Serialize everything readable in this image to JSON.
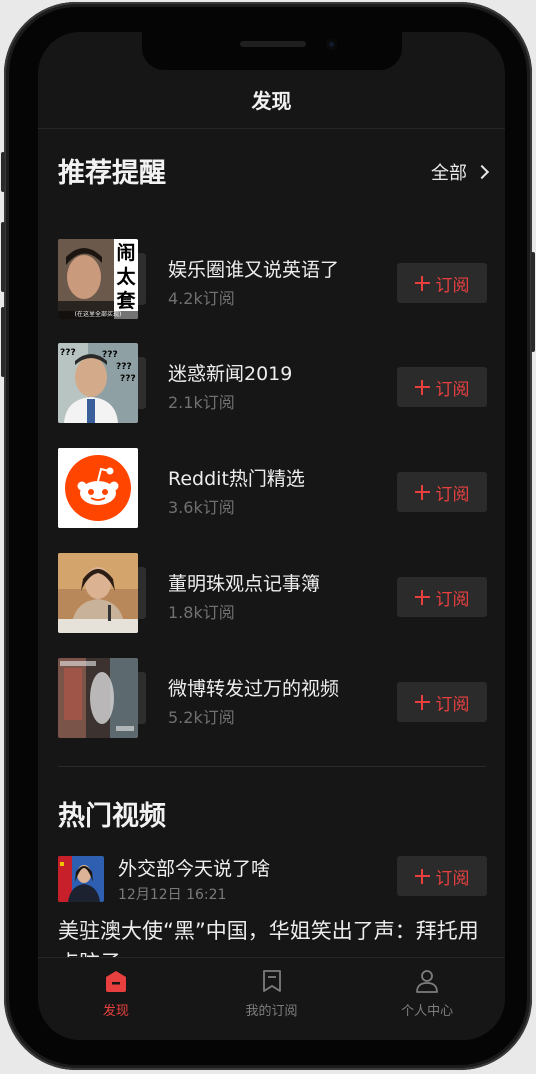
{
  "header": {
    "title": "发现"
  },
  "recommend": {
    "title": "推荐提醒",
    "see_all": "全部",
    "thumb_overlay_text": "闹太套",
    "thumb_caption_text": "(在这里全部买现)",
    "items": [
      {
        "title": "娱乐圈谁又说英语了",
        "subscribers": "4.2k订阅",
        "button": "订阅",
        "thumb": "portrait-man-icon"
      },
      {
        "title": "迷惑新闻2019",
        "subscribers": "2.1k订阅",
        "button": "订阅",
        "thumb": "confused-man-icon"
      },
      {
        "title": "Reddit热门精选",
        "subscribers": "3.6k订阅",
        "button": "订阅",
        "thumb": "reddit-logo-icon"
      },
      {
        "title": "董明珠观点记事簿",
        "subscribers": "1.8k订阅",
        "button": "订阅",
        "thumb": "woman-speaking-icon"
      },
      {
        "title": "微博转发过万的视频",
        "subscribers": "5.2k订阅",
        "button": "订阅",
        "thumb": "video-still-icon"
      }
    ]
  },
  "hot_videos": {
    "title": "热门视频",
    "item": {
      "title": "外交部今天说了啥",
      "time": "12月12日 16:21",
      "button": "订阅",
      "text": "美驻澳大使“黑”中国，华姐笑出了声：拜托用点脑子。"
    }
  },
  "tabs": [
    {
      "label": "发现",
      "icon": "home-icon",
      "active": true
    },
    {
      "label": "我的订阅",
      "icon": "bookmark-icon",
      "active": false
    },
    {
      "label": "个人中心",
      "icon": "person-icon",
      "active": false
    }
  ],
  "colors": {
    "accent": "#e8403f",
    "background": "#161616",
    "button_bg": "#2b2b2b"
  }
}
